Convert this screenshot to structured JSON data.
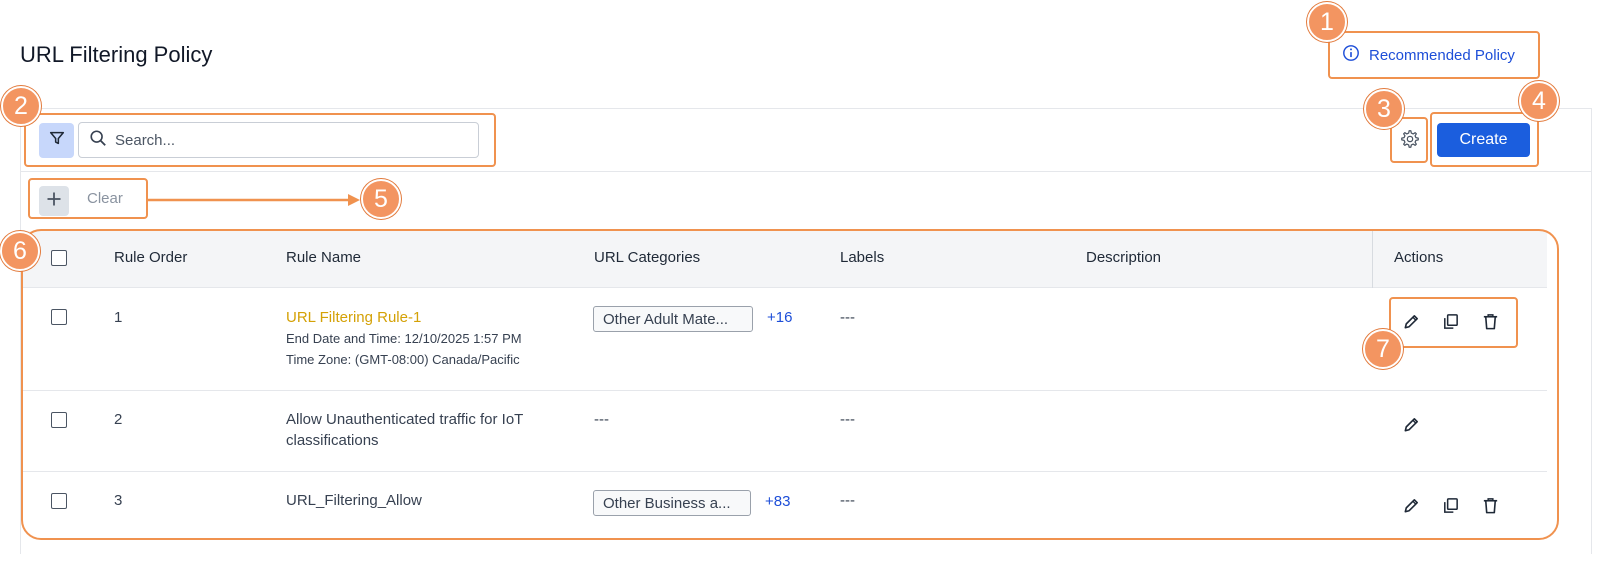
{
  "page": {
    "title": "URL Filtering Policy"
  },
  "header": {
    "recommended_label": "Recommended Policy"
  },
  "toolbar": {
    "search_placeholder": "Search...",
    "create_label": "Create",
    "clear_label": "Clear"
  },
  "table": {
    "columns": [
      "Rule Order",
      "Rule Name",
      "URL Categories",
      "Labels",
      "Description",
      "Actions"
    ],
    "rows": [
      {
        "order": "1",
        "name": "URL Filtering Rule-1",
        "end_date": "End Date and Time: 12/10/2025 1:57 PM",
        "time_zone": "Time Zone: (GMT-08:00) Canada/Pacific",
        "category": "Other Adult Mate...",
        "more": "+16",
        "labels": "---"
      },
      {
        "order": "2",
        "name_line1": "Allow Unauthenticated traffic for IoT",
        "name_line2": "classifications",
        "category": "---",
        "labels": "---"
      },
      {
        "order": "3",
        "name": "URL_Filtering_Allow",
        "category": "Other Business a...",
        "more": "+83",
        "labels": "---"
      }
    ]
  },
  "callouts": [
    "1",
    "2",
    "3",
    "4",
    "5",
    "6",
    "7"
  ],
  "icons": {
    "info": "info-icon",
    "filter": "filter-icon",
    "search": "search-icon",
    "gear": "gear-icon",
    "plus": "plus-icon",
    "edit": "pencil-icon",
    "copy": "copy-icon",
    "delete": "trash-icon"
  },
  "colors": {
    "accent": "#1b5ede",
    "link": "#1d4ed8",
    "rule_link": "#d4a106",
    "callout": "#f39561"
  }
}
